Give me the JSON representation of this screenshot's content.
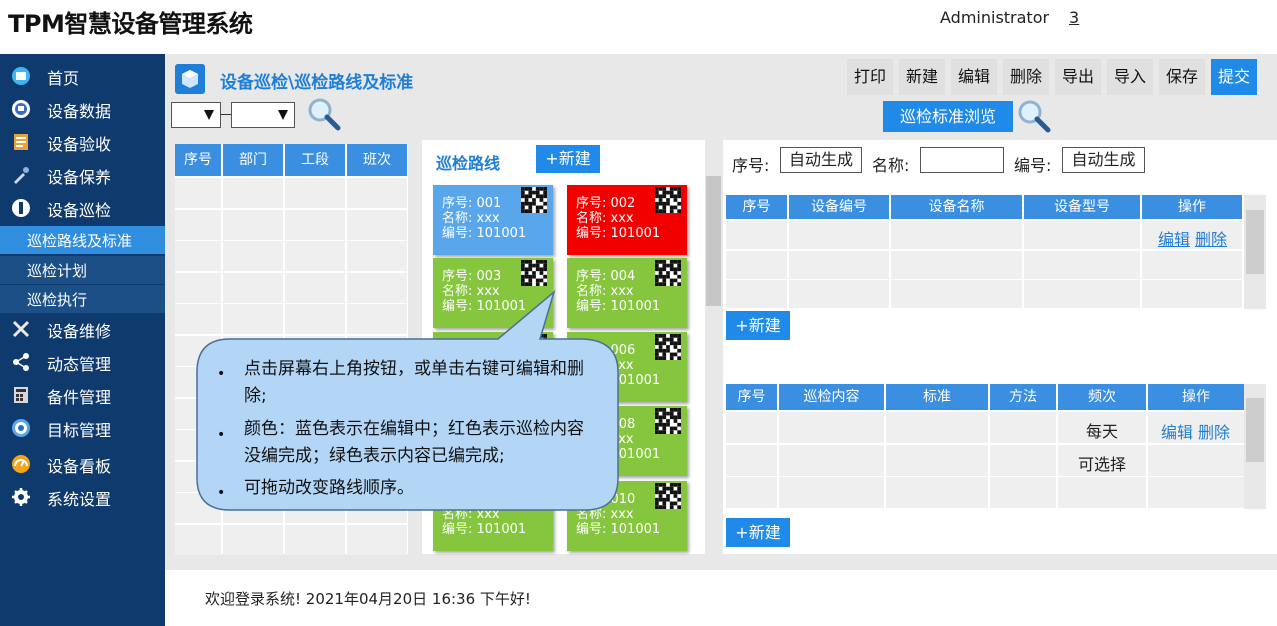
{
  "app": {
    "title": "TPM智慧设备管理系统"
  },
  "header": {
    "user": "Administrator",
    "count": "3"
  },
  "sidebar": {
    "items": [
      {
        "label": "首页",
        "icon": "home-icon"
      },
      {
        "label": "设备数据",
        "icon": "monitor-icon"
      },
      {
        "label": "设备验收",
        "icon": "clipboard-icon"
      },
      {
        "label": "设备保养",
        "icon": "maintenance-icon"
      },
      {
        "label": "设备巡检",
        "icon": "inspection-icon"
      },
      {
        "label": "设备维修",
        "icon": "wrench-icon"
      },
      {
        "label": "动态管理",
        "icon": "share-icon"
      },
      {
        "label": "备件管理",
        "icon": "calculator-icon"
      },
      {
        "label": "目标管理",
        "icon": "target-icon"
      },
      {
        "label": "设备看板",
        "icon": "dashboard-icon"
      },
      {
        "label": "系统设置",
        "icon": "gear-icon"
      }
    ],
    "subitems": [
      {
        "label": "巡检路线及标准",
        "active": true
      },
      {
        "label": "巡检计划",
        "active": false
      },
      {
        "label": "巡检执行",
        "active": false
      }
    ]
  },
  "page": {
    "title": "设备巡检\\巡检路线及标准",
    "browse_label": "巡检标准浏览"
  },
  "toolbar": {
    "print": "打印",
    "new": "新建",
    "edit": "编辑",
    "delete": "删除",
    "export": "导出",
    "import": "导入",
    "save": "保存",
    "submit": "提交"
  },
  "left_table": {
    "headers": [
      "序号",
      "部门",
      "工段",
      "班次"
    ]
  },
  "route": {
    "label": "巡检路线",
    "new_label": "+新建",
    "cards": [
      {
        "l1": "序号: 001",
        "l2": "名称: xxx",
        "l3": "编号: 101001",
        "status": "editing"
      },
      {
        "l1": "序号: 002",
        "l2": "名称: xxx",
        "l3": "编号: 101001",
        "status": "incomplete"
      },
      {
        "l1": "序号: 003",
        "l2": "名称: xxx",
        "l3": "编号: 101001",
        "status": "complete"
      },
      {
        "l1": "序号: 004",
        "l2": "名称: xxx",
        "l3": "编号: 101001",
        "status": "complete"
      },
      {
        "l1": "",
        "l2": "",
        "l3": "",
        "status": "complete"
      },
      {
        "l1": "序号: 006",
        "l2": "名称: xxx",
        "l3": "编号: 101001",
        "status": "complete"
      },
      {
        "l1": "",
        "l2": "",
        "l3": "",
        "status": "complete"
      },
      {
        "l1": "序号: 008",
        "l2": "名称: xxx",
        "l3": "编号: 101001",
        "status": "complete"
      },
      {
        "l1": "",
        "l2": "名称: xxx",
        "l3": "编号: 101001",
        "status": "complete"
      },
      {
        "l1": "序号: 010",
        "l2": "名称: xxx",
        "l3": "编号: 101001",
        "status": "complete"
      }
    ]
  },
  "colors": {
    "editing": "#5aa6ea",
    "incomplete": "#f20000",
    "complete": "#86c63e",
    "accent": "#1f8ae8",
    "sidebar": "#0e3a6e"
  },
  "form": {
    "seq_label": "序号:",
    "seq_value": "自动生成",
    "name_label": "名称:",
    "name_value": "",
    "code_label": "编号:",
    "code_value": "自动生成"
  },
  "equipment_table": {
    "headers": [
      "序号",
      "设备编号",
      "设备名称",
      "设备型号",
      "操作"
    ],
    "actions": {
      "edit": "编辑",
      "delete": "删除"
    },
    "new_label": "+新建"
  },
  "content_table": {
    "headers": [
      "序号",
      "巡检内容",
      "标准",
      "方法",
      "频次",
      "操作"
    ],
    "rows": [
      {
        "frequency": "每天",
        "edit": "编辑",
        "delete": "删除"
      },
      {
        "frequency": "可选择",
        "edit": "",
        "delete": ""
      }
    ],
    "new_label": "+新建"
  },
  "notes": [
    "点击屏幕右上角按钮，或单击右键可编辑和删除;",
    "颜色：蓝色表示在编辑中；红色表示巡检内容没编完成；绿色表示内容已编完成;",
    "可拖动改变路线顺序。"
  ],
  "footer": {
    "text": "欢迎登录系统!   2021年04月20日 16:36 下午好!"
  }
}
